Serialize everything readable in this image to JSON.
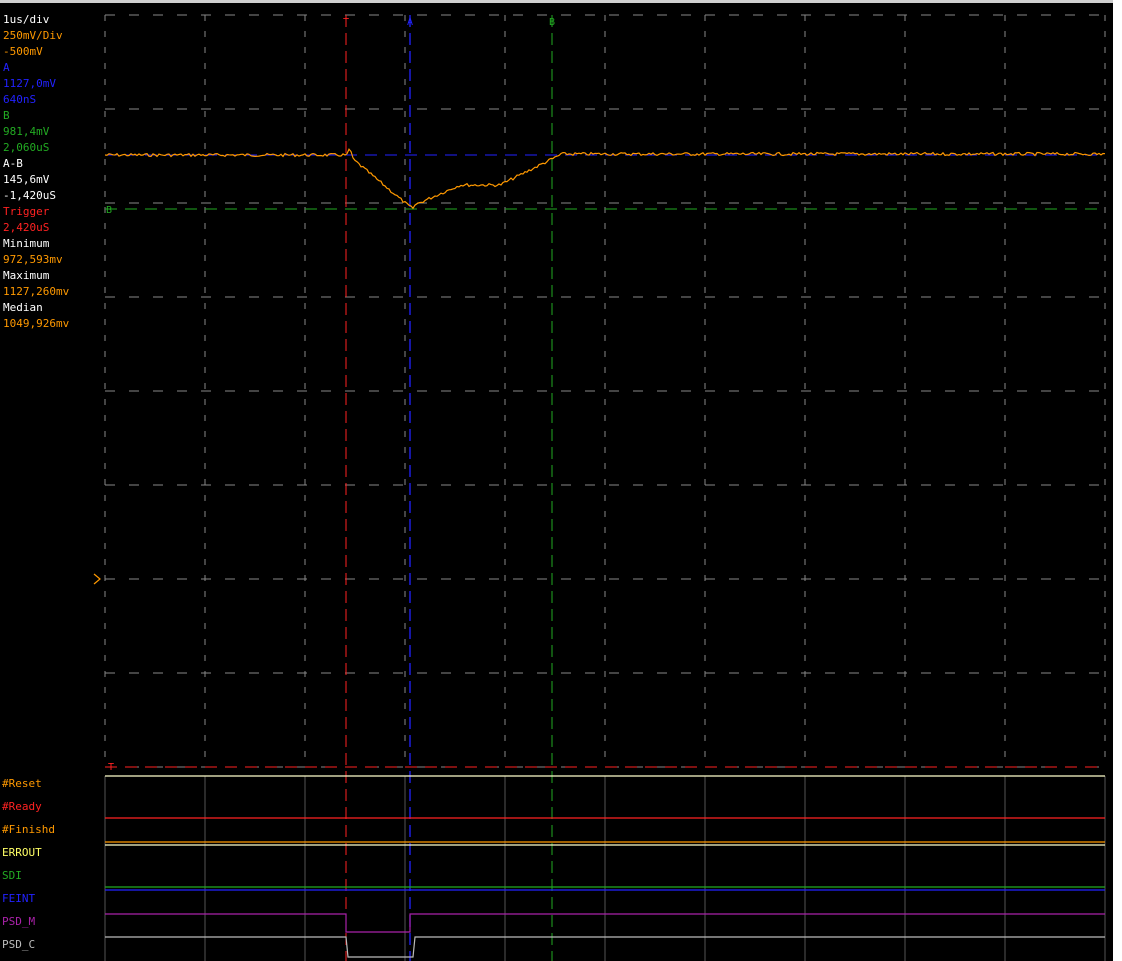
{
  "readouts": [
    {
      "text": "1us/div",
      "color": "#ffffff"
    },
    {
      "text": "250mV/Div",
      "color": "#ff9900"
    },
    {
      "text": "-500mV",
      "color": "#ff9900"
    },
    {
      "text": "A",
      "color": "#2222ff"
    },
    {
      "text": "1127,0mV",
      "color": "#2222ff"
    },
    {
      "text": "640nS",
      "color": "#2222ff"
    },
    {
      "text": "B",
      "color": "#22aa22"
    },
    {
      "text": "981,4mV",
      "color": "#22aa22"
    },
    {
      "text": "2,060uS",
      "color": "#22aa22"
    },
    {
      "text": "A-B",
      "color": "#ffffff"
    },
    {
      "text": "145,6mV",
      "color": "#ffffff"
    },
    {
      "text": "-1,420uS",
      "color": "#ffffff"
    },
    {
      "text": "Trigger",
      "color": "#ff2222"
    },
    {
      "text": "2,420uS",
      "color": "#ff2222"
    },
    {
      "text": "Minimum",
      "color": "#ffffff"
    },
    {
      "text": "972,593mv",
      "color": "#ff9900"
    },
    {
      "text": "Maximum",
      "color": "#ffffff"
    },
    {
      "text": "1127,260mv",
      "color": "#ff9900"
    },
    {
      "text": "Median",
      "color": "#ffffff"
    },
    {
      "text": "1049,926mv",
      "color": "#ff9900"
    }
  ],
  "cursor_labels": {
    "trigger": "T",
    "a": "A",
    "b": "B",
    "b_level": "B",
    "t_level": "T"
  },
  "digital_channels": [
    {
      "name": "#Reset",
      "color": "#ff9900",
      "line_color": "#ffffcc"
    },
    {
      "name": "#Ready",
      "color": "#ff2222",
      "line_color": "#ff2222"
    },
    {
      "name": "#Finishd",
      "color": "#ff9900",
      "line_color": "#ff9900"
    },
    {
      "name": "ERROUT",
      "color": "#ffff66",
      "line_color": "#ffffcc"
    },
    {
      "name": "SDI",
      "color": "#22aa22",
      "line_color": "#22aa22"
    },
    {
      "name": "FEINT",
      "color": "#2222ff",
      "line_color": "#2222ff"
    },
    {
      "name": "PSD_M",
      "color": "#aa22aa",
      "line_color": "#aa22aa"
    },
    {
      "name": "PSD_C",
      "color": "#bbbbbb",
      "line_color": "#bbbbbb"
    }
  ],
  "colors": {
    "trace": "#ff9900",
    "grid": "#888888",
    "trigger_cursor": "#ff2222",
    "cursor_a": "#2222ff",
    "cursor_b": "#22aa22"
  }
}
